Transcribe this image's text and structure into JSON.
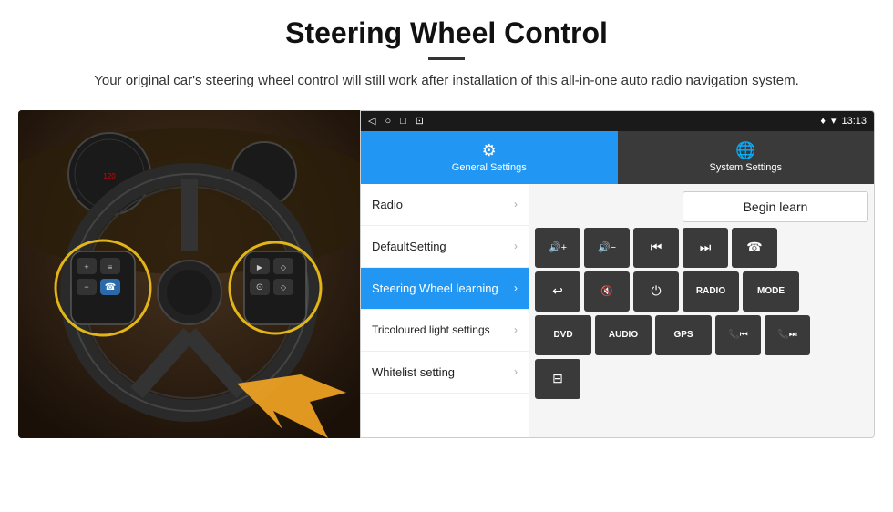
{
  "header": {
    "title": "Steering Wheel Control",
    "subtitle": "Your original car's steering wheel control will still work after installation of this all-in-one auto radio navigation system."
  },
  "statusBar": {
    "time": "13:13",
    "icons": [
      "◁",
      "○",
      "□",
      "⊡"
    ]
  },
  "tabs": [
    {
      "id": "general",
      "label": "General Settings",
      "active": true
    },
    {
      "id": "system",
      "label": "System Settings",
      "active": false
    }
  ],
  "menuItems": [
    {
      "id": "radio",
      "label": "Radio",
      "active": false
    },
    {
      "id": "default",
      "label": "DefaultSetting",
      "active": false
    },
    {
      "id": "steering",
      "label": "Steering Wheel learning",
      "active": true
    },
    {
      "id": "tricoloured",
      "label": "Tricoloured light settings",
      "active": false
    },
    {
      "id": "whitelist",
      "label": "Whitelist setting",
      "active": false
    }
  ],
  "beginLearn": "Begin learn",
  "controlButtons": {
    "row1": [
      {
        "id": "vol-up",
        "label": "▶|+",
        "symbol": "🔊+"
      },
      {
        "id": "vol-down",
        "label": "▶|-",
        "symbol": "🔊−"
      },
      {
        "id": "prev-track",
        "label": "|◀◀",
        "symbol": "⏮"
      },
      {
        "id": "next-track",
        "label": "▶▶|",
        "symbol": "⏭"
      },
      {
        "id": "phone",
        "label": "☎",
        "symbol": "☎"
      }
    ],
    "row2": [
      {
        "id": "hook",
        "label": "↩",
        "symbol": "↩"
      },
      {
        "id": "mute",
        "label": "🔇",
        "symbol": "🔇"
      },
      {
        "id": "power",
        "label": "⏻",
        "symbol": "⏻"
      },
      {
        "id": "radio-btn",
        "label": "RADIO",
        "symbol": "RADIO"
      },
      {
        "id": "mode",
        "label": "MODE",
        "symbol": "MODE"
      }
    ],
    "row3": [
      {
        "id": "dvd",
        "label": "DVD",
        "symbol": "DVD"
      },
      {
        "id": "audio",
        "label": "AUDIO",
        "symbol": "AUDIO"
      },
      {
        "id": "gps",
        "label": "GPS",
        "symbol": "GPS"
      },
      {
        "id": "phone-prev",
        "label": "📞⏮",
        "symbol": "📞⏮"
      },
      {
        "id": "phone-next",
        "label": "📞⏭",
        "symbol": "📞⏭"
      }
    ]
  },
  "scanIcon": "⊟"
}
